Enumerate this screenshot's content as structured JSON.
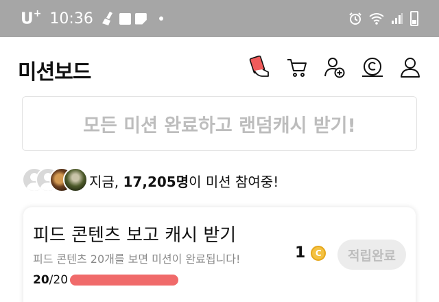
{
  "status_bar": {
    "carrier": "U",
    "carrier_plus": "+",
    "time": "10:36"
  },
  "header": {
    "title": "미션보드",
    "icons": [
      "card-hand-icon",
      "cart-icon",
      "add-friend-icon",
      "cash-coin-icon",
      "profile-icon"
    ]
  },
  "banner": {
    "text": "모든 미션 완료하고 랜덤캐시 받기!"
  },
  "participants": {
    "prefix": "지금, ",
    "count": "17,205명",
    "suffix": "이 미션 참여중!"
  },
  "mission": {
    "title": "피드 콘텐츠 보고 캐시 받기",
    "description": "피드 콘텐츠 20개를 보면 미션이 완료됩니다!",
    "progress_current": "20",
    "progress_total": "/20",
    "progress_fraction": 1.0,
    "reward_amount": "1",
    "coin_symbol": "C",
    "button_label": "적립완료"
  },
  "colors": {
    "status_bar_bg": "#a6a6a6",
    "progress_fill": "#f06a6a",
    "coin": "#f4c242",
    "disabled_text": "#bdbdbd"
  }
}
